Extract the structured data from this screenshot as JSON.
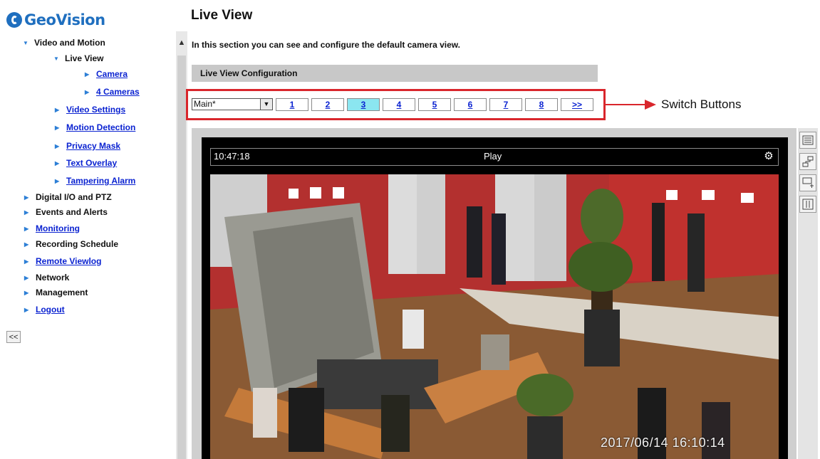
{
  "brand": {
    "logo_text": "GeoVision"
  },
  "sidebar": {
    "items": [
      {
        "label": "Video and Motion",
        "link": false,
        "expanded": true
      },
      {
        "label": "Live View",
        "link": false,
        "expanded": true
      },
      {
        "label": "Camera",
        "link": true
      },
      {
        "label": "4 Cameras",
        "link": true
      },
      {
        "label": "Video Settings",
        "link": true
      },
      {
        "label": "Motion Detection",
        "link": true
      },
      {
        "label": "Privacy Mask",
        "link": true
      },
      {
        "label": "Text Overlay",
        "link": true
      },
      {
        "label": "Tampering Alarm",
        "link": true
      },
      {
        "label": "Digital I/O and PTZ",
        "link": false
      },
      {
        "label": "Events and Alerts",
        "link": false
      },
      {
        "label": "Monitoring",
        "link": true
      },
      {
        "label": "Recording Schedule",
        "link": false
      },
      {
        "label": "Remote Viewlog",
        "link": true
      },
      {
        "label": "Network",
        "link": false
      },
      {
        "label": "Management",
        "link": false
      },
      {
        "label": "Logout",
        "link": true
      }
    ],
    "collapse_label": "<<"
  },
  "main": {
    "title": "Live View",
    "intro": "In this section you can see and configure the default camera view.",
    "section_header": "Live View Configuration",
    "stream_select": {
      "value": "Main*"
    },
    "channel_buttons": [
      "1",
      "2",
      "3",
      "4",
      "5",
      "6",
      "7",
      "8",
      ">>"
    ],
    "active_channel": "3",
    "annotation": "Switch Buttons"
  },
  "viewer": {
    "time": "10:47:18",
    "status": "Play",
    "timestamp": "2017/06/14  16:10:14"
  },
  "colors": {
    "link": "#0b23d1",
    "highlight_frame": "#d9262c",
    "active_button": "#8be6f0",
    "brand": "#1f6fbf"
  }
}
